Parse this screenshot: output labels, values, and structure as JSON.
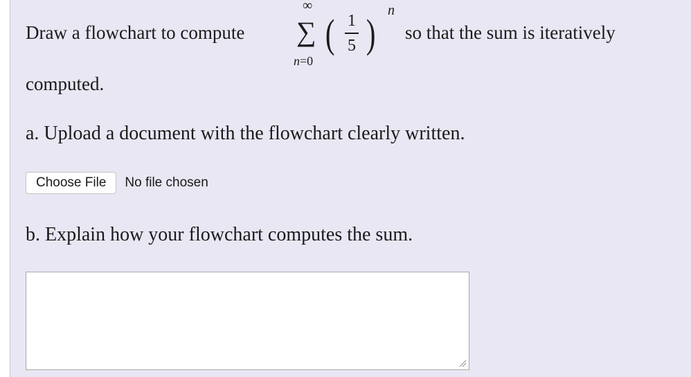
{
  "question": {
    "intro": "Draw a flowchart to compute",
    "tail": "so that the sum is iteratively",
    "line2": "computed.",
    "formula": {
      "operator": "∑",
      "upper_limit": "∞",
      "lower_var": "n",
      "lower_eq": "=",
      "lower_start": "0",
      "numerator": "1",
      "denominator": "5",
      "exponent": "n",
      "left_paren": "(",
      "right_paren": ")"
    }
  },
  "part_a": {
    "text": "a. Upload a document with the flowchart clearly written.",
    "file_button_label": "Choose File",
    "file_status": "No file chosen"
  },
  "part_b": {
    "text": "b. Explain how your flowchart computes the sum.",
    "answer_value": ""
  },
  "icons": {
    "resize": "resize-grip-icon"
  }
}
